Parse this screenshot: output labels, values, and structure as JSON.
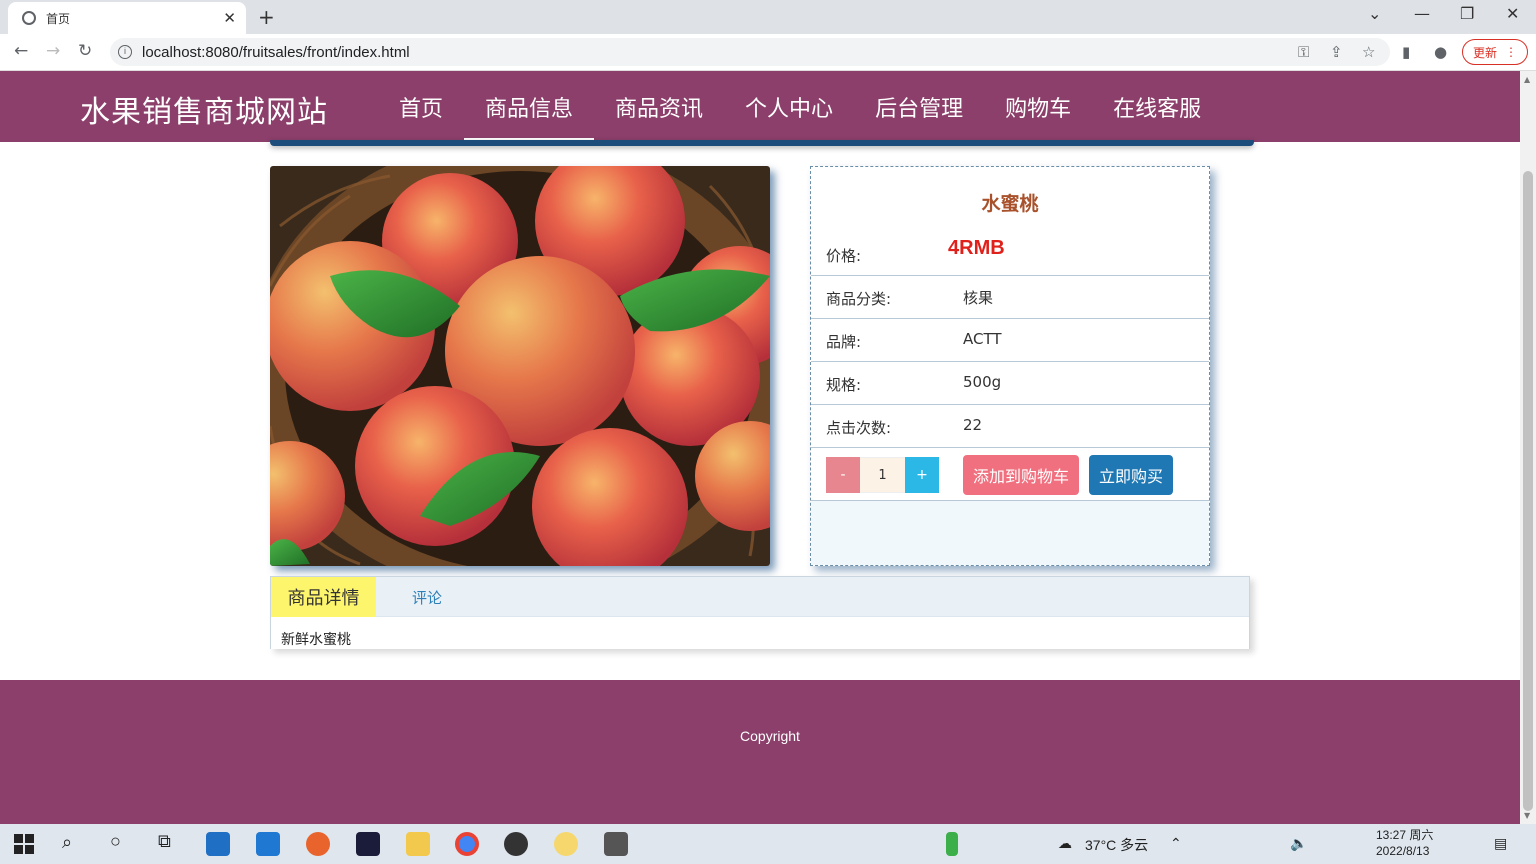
{
  "browser": {
    "tab_title": "首页",
    "url": "localhost:8080/fruitsales/front/index.html",
    "update_label": "更新"
  },
  "site": {
    "title": "水果销售商城网站",
    "nav": [
      "首页",
      "商品信息",
      "商品资讯",
      "个人中心",
      "后台管理",
      "购物车",
      "在线客服"
    ],
    "active_nav": "商品信息"
  },
  "product": {
    "name": "水蜜桃",
    "price_label": "价格:",
    "price_value": "4RMB",
    "category_label": "商品分类:",
    "category_value": "核果",
    "brand_label": "品牌:",
    "brand_value": "ACTT",
    "spec_label": "规格:",
    "spec_value": "500g",
    "clicks_label": "点击次数:",
    "clicks_value": "22",
    "qty_minus": "-",
    "qty_value": "1",
    "qty_plus": "+",
    "add_cart_label": "添加到购物车",
    "buy_now_label": "立即购买"
  },
  "detail": {
    "tab_detail": "商品详情",
    "tab_comments": "评论",
    "text": "新鲜水蜜桃"
  },
  "footer": {
    "copyright": "Copyright"
  },
  "taskbar": {
    "weather": "37°C 多云",
    "time": "13:27 周六",
    "date": "2022/8/13"
  },
  "colors": {
    "header_bg": "#8b3f6a",
    "price": "#e0201b",
    "cart_btn": "#f0707f",
    "buy_btn": "#1f78b4"
  }
}
